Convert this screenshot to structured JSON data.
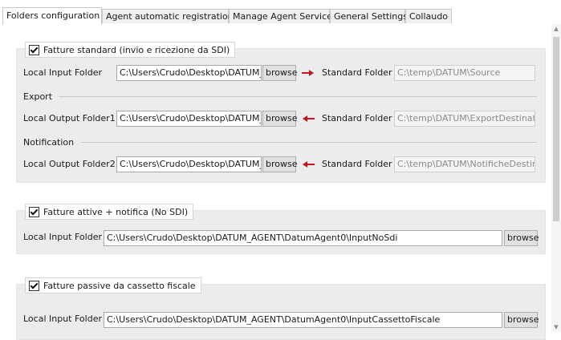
{
  "tabs": [
    {
      "label": "Folders configuration",
      "active": true
    },
    {
      "label": "Agent automatic registration",
      "active": false
    },
    {
      "label": "Manage Agent Service",
      "active": false
    },
    {
      "label": "General Settings",
      "active": false
    },
    {
      "label": "Collaudo",
      "active": false
    }
  ],
  "group1": {
    "title": "Fatture standard (invio e ricezione da SDI)",
    "checked": true,
    "rows": [
      {
        "label": "Local Input Folder",
        "value": "C:\\Users\\Crudo\\Desktop\\DATUM_/",
        "browse": "browse",
        "arrow": "right",
        "target_label": "Standard Folder",
        "target_value": "C:\\temp\\DATUM\\Source"
      },
      {
        "label": "Local Output Folder1",
        "value": "C:\\Users\\Crudo\\Desktop\\DATUM_/",
        "browse": "browse",
        "arrow": "left",
        "target_label": "Standard Folder",
        "target_value": "C:\\temp\\DATUM\\ExportDestinatio"
      },
      {
        "label": "Local Output Folder2",
        "value": "C:\\Users\\Crudo\\Desktop\\DATUM_/",
        "browse": "browse",
        "arrow": "left",
        "target_label": "Standard Folder",
        "target_value": "C:\\temp\\DATUM\\NotificheDestina"
      }
    ],
    "sections": {
      "export": "Export",
      "notification": "Notification"
    }
  },
  "group2": {
    "title": "Fatture attive + notifica (No SDI)",
    "checked": true,
    "label": "Local Input Folder",
    "value": "C:\\Users\\Crudo\\Desktop\\DATUM_AGENT\\DatumAgent0\\InputNoSdi",
    "browse": "browse"
  },
  "group3": {
    "title": "Fatture passive da cassetto fiscale",
    "checked": true,
    "label": "Local Input Folder",
    "value": "C:\\Users\\Crudo\\Desktop\\DATUM_AGENT\\DatumAgent0\\InputCassettoFiscale",
    "browse": "browse"
  },
  "colors": {
    "arrow": "#c0161c",
    "group_bg": "#ececec",
    "accent_border": "#a9a9a9"
  },
  "icons": {
    "checkbox": "checkmark-icon",
    "arrow_right": "arrow-right-icon",
    "arrow_left": "arrow-left-icon"
  }
}
